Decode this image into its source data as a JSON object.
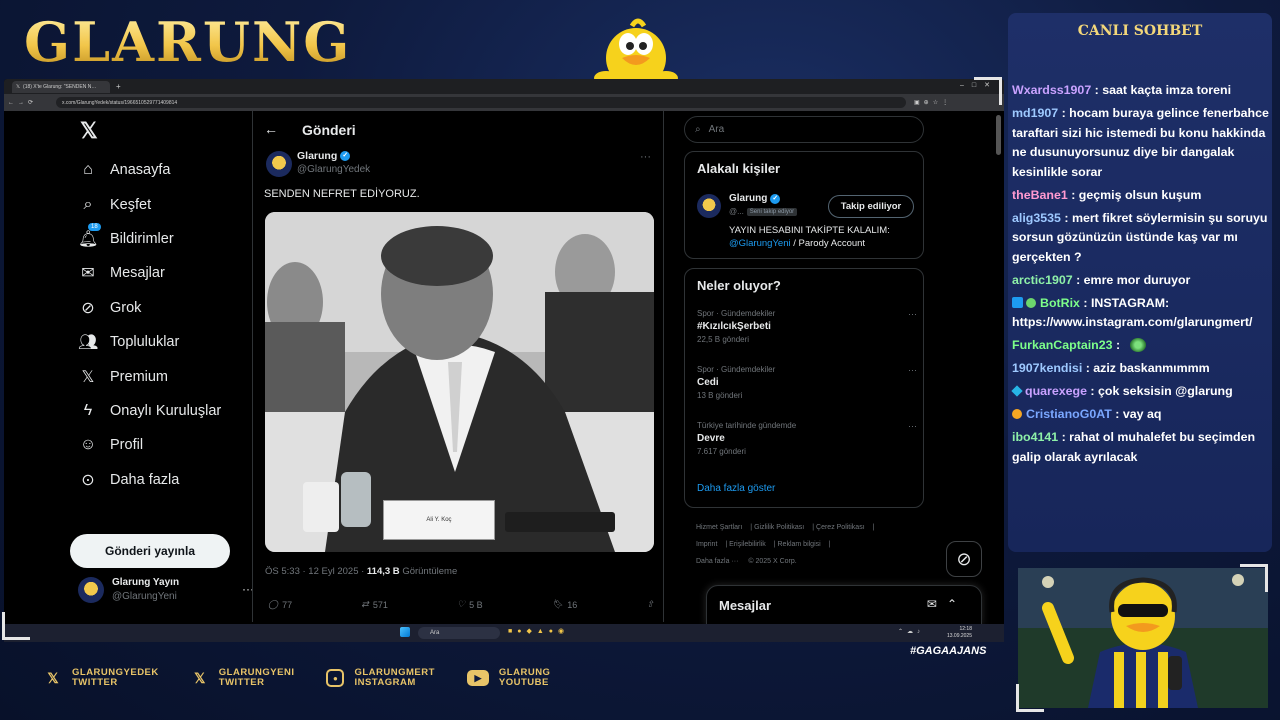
{
  "overlay": {
    "logo": "GLARUNG",
    "hashtag": "#GAGAAJANS",
    "socials": [
      {
        "icon": "x-icon",
        "line1": "GLARUNGYEDEK",
        "line2": "TWITTER"
      },
      {
        "icon": "x-icon",
        "line1": "GLARUNGYENI",
        "line2": "TWITTER"
      },
      {
        "icon": "instagram-icon",
        "line1": "GLARUNGMERT",
        "line2": "INSTAGRAM"
      },
      {
        "icon": "youtube-icon",
        "line1": "GLARUNG",
        "line2": "YOUTUBE"
      }
    ],
    "accent_color": "#e8c468"
  },
  "browser": {
    "tab_title": "(18) X'te Glarung: \"SENDEN N…",
    "url": "x.com/GlarungYedek/status/1966510529771409814"
  },
  "x": {
    "nav": [
      {
        "icon": "home-icon",
        "label": "Anasayfa"
      },
      {
        "icon": "search-icon",
        "label": "Keşfet"
      },
      {
        "icon": "bell-icon",
        "label": "Bildirimler",
        "badge": "18"
      },
      {
        "icon": "mail-icon",
        "label": "Mesajlar"
      },
      {
        "icon": "grok-icon",
        "label": "Grok"
      },
      {
        "icon": "communities-icon",
        "label": "Topluluklar"
      },
      {
        "icon": "x-icon",
        "label": "Premium"
      },
      {
        "icon": "lightning-icon",
        "label": "Onaylı Kuruluşlar"
      },
      {
        "icon": "person-icon",
        "label": "Profil"
      },
      {
        "icon": "more-circle-icon",
        "label": "Daha fazla"
      }
    ],
    "post_button": "Gönderi yayınla",
    "account": {
      "name": "Glarung Yayın",
      "handle": "@GlarungYeni"
    },
    "header_title": "Gönderi",
    "post": {
      "name": "Glarung",
      "handle": "@GlarungYedek",
      "text": "SENDEN NEFRET EDİYORUZ.",
      "photo_nameplate": "Ali Y. Koç",
      "time": "ÖS 5:33 · 12 Eyl 2025 ·",
      "views": "114,3 B",
      "views_label": "Görüntüleme",
      "replies": "77",
      "reposts": "571",
      "likes": "5 B",
      "bookmarks": "16"
    },
    "search_placeholder": "Ara",
    "related": {
      "title": "Alakalı kişiler",
      "name": "Glarung",
      "handle": "@...",
      "follows_you": "Seni takip ediyor",
      "follow_button": "Takip ediliyor",
      "bio_prefix": "YAYIN HESABINI TAKİPTE KALALIM:",
      "bio_link": "@GlarungYeni",
      "bio_suffix": "/ Parody Account"
    },
    "trends": {
      "title": "Neler oluyor?",
      "items": [
        {
          "category": "Spor · Gündemdekiler",
          "name": "#KızılcıkŞerbeti",
          "count": "22,5 B gönderi"
        },
        {
          "category": "Spor · Gündemdekiler",
          "name": "Cedi",
          "count": "13 B gönderi"
        },
        {
          "category": "Türkiye tarihinde gündemde",
          "name": "Devre",
          "count": "7.617 gönderi"
        }
      ],
      "show_more": "Daha fazla göster"
    },
    "footer": [
      "Hizmet Şartları",
      "Gizlilik Politikası",
      "Çerez Politikası",
      "Imprint",
      "Erişilebilirlik",
      "Reklam bilgisi",
      "Daha fazla ···",
      "© 2025 X Corp."
    ],
    "messages_dock": "Mesajlar",
    "brand_color": "#1d9bf0"
  },
  "taskbar": {
    "search": "Ara",
    "time": "12:18",
    "date": "13.09.2025"
  },
  "chat": {
    "title": "CANLI SOHBET",
    "messages": [
      {
        "user": "Wxardss1907",
        "color": "#c9a2ff",
        "text": "saat kaçta imza toreni"
      },
      {
        "user": "md1907",
        "color": "#9ec9ff",
        "text": "hocam buraya gelince fenerbahce taraftari sizi hic istemedi bu konu hakkinda ne dusunuyorsunuz diye bir dangalak kesinlikle sorar"
      },
      {
        "user": "theBane1",
        "color": "#ff9ad1",
        "text": "geçmiş olsun kuşum"
      },
      {
        "user": "alig3535",
        "color": "#9ec9ff",
        "text": "mert fikret söylermisin şu soruyu sorsun gözünüzün üstünde kaş var mı gerçekten ?"
      },
      {
        "user": "arctic1907",
        "color": "#8ef0a8",
        "text": "emre mor duruyor"
      },
      {
        "user": "BotRix",
        "color": "#7dff8a",
        "text": "INSTAGRAM: https://www.instagram.com/glarungmert/",
        "badges": [
          "bot",
          "verified"
        ]
      },
      {
        "user": "FurkanCaptain23",
        "color": "#7dff8a",
        "text": "",
        "emote": true
      },
      {
        "user": "1907kendisi",
        "color": "#9ec9ff",
        "text": "aziz baskanmımmm"
      },
      {
        "user": "quarexege",
        "color": "#c9a2ff",
        "text": "çok seksisin @glarung",
        "badges": [
          "cube"
        ]
      },
      {
        "user": "CristianoG0AT",
        "color": "#7aa7ff",
        "text": "vay aq",
        "badges": [
          "coin"
        ]
      },
      {
        "user": "ibo4141",
        "color": "#8ef0a8",
        "text": "rahat ol muhalefet bu seçimden galip olarak ayrılacak"
      }
    ]
  }
}
